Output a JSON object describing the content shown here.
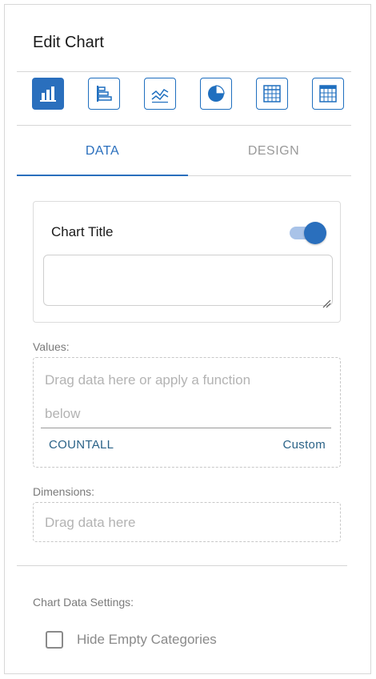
{
  "header": {
    "title": "Edit Chart"
  },
  "chart_types": [
    {
      "icon": "vertical-bar-chart-icon",
      "active": true
    },
    {
      "icon": "horizontal-bar-chart-icon",
      "active": false
    },
    {
      "icon": "line-chart-icon",
      "active": false
    },
    {
      "icon": "pie-chart-icon",
      "active": false
    },
    {
      "icon": "table-icon",
      "active": false
    },
    {
      "icon": "pivot-table-icon",
      "active": false
    }
  ],
  "tabs": {
    "data_label": "DATA",
    "design_label": "DESIGN",
    "active": "DATA"
  },
  "chart_title": {
    "label": "Chart Title",
    "toggle_on": true,
    "value": ""
  },
  "values": {
    "label": "Values:",
    "placeholder_line1": "Drag data here or apply a function",
    "placeholder_line2": "below",
    "function_countall": "COUNTALL",
    "function_custom": "Custom"
  },
  "dimensions": {
    "label": "Dimensions:",
    "placeholder": "Drag data here"
  },
  "settings": {
    "label": "Chart Data Settings:",
    "hide_empty_categories_label": "Hide Empty Categories",
    "hide_empty_categories_checked": false
  },
  "colors": {
    "accent": "#2a6fbd",
    "toggle_track": "#a9c3e8",
    "link": "#2a6287"
  }
}
